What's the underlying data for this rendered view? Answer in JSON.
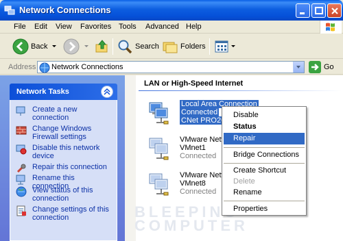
{
  "window": {
    "title": "Network Connections"
  },
  "menu": {
    "items": [
      "File",
      "Edit",
      "View",
      "Favorites",
      "Tools",
      "Advanced",
      "Help"
    ]
  },
  "toolbar": {
    "back_label": "Back",
    "search_label": "Search",
    "folders_label": "Folders"
  },
  "address": {
    "label": "Address",
    "value": "Network Connections",
    "go_label": "Go"
  },
  "tasks": {
    "header": "Network Tasks",
    "items": [
      {
        "label": "Create a new connection",
        "icon": "new-connection-icon"
      },
      {
        "label": "Change Windows Firewall settings",
        "icon": "firewall-icon"
      },
      {
        "label": "Disable this network device",
        "icon": "disable-network-icon"
      },
      {
        "label": "Repair this connection",
        "icon": "repair-icon"
      },
      {
        "label": "Rename this connection",
        "icon": "rename-icon"
      },
      {
        "label": "View status of this connection",
        "icon": "status-icon"
      },
      {
        "label": "Change settings of this connection",
        "icon": "settings-icon"
      }
    ]
  },
  "main": {
    "section_title": "LAN or High-Speed Internet",
    "connections": [
      {
        "name": "Local Area Connection",
        "status": "Connected",
        "device": "CNet PRO200",
        "selected": true
      },
      {
        "name": "VMware Netw",
        "status": "Connected",
        "device": "VMnet1",
        "selected": false
      },
      {
        "name": "VMware Netw",
        "status": "Connected",
        "device": "VMnet8",
        "selected": false
      }
    ]
  },
  "context_menu": {
    "items": [
      {
        "label": "Disable",
        "style": "normal"
      },
      {
        "label": "Status",
        "style": "bold"
      },
      {
        "label": "Repair",
        "style": "hover"
      },
      {
        "label": "Bridge Connections",
        "style": "normal"
      },
      {
        "label": "Create Shortcut",
        "style": "normal"
      },
      {
        "label": "Delete",
        "style": "disabled"
      },
      {
        "label": "Rename",
        "style": "normal"
      },
      {
        "label": "Properties",
        "style": "normal"
      }
    ]
  },
  "watermark": {
    "line1": "BLEEPING",
    "line2": "COMPUTER"
  },
  "colors": {
    "title_blue": "#0550d8",
    "selection": "#316ac5",
    "task_link": "#0c31a6"
  }
}
